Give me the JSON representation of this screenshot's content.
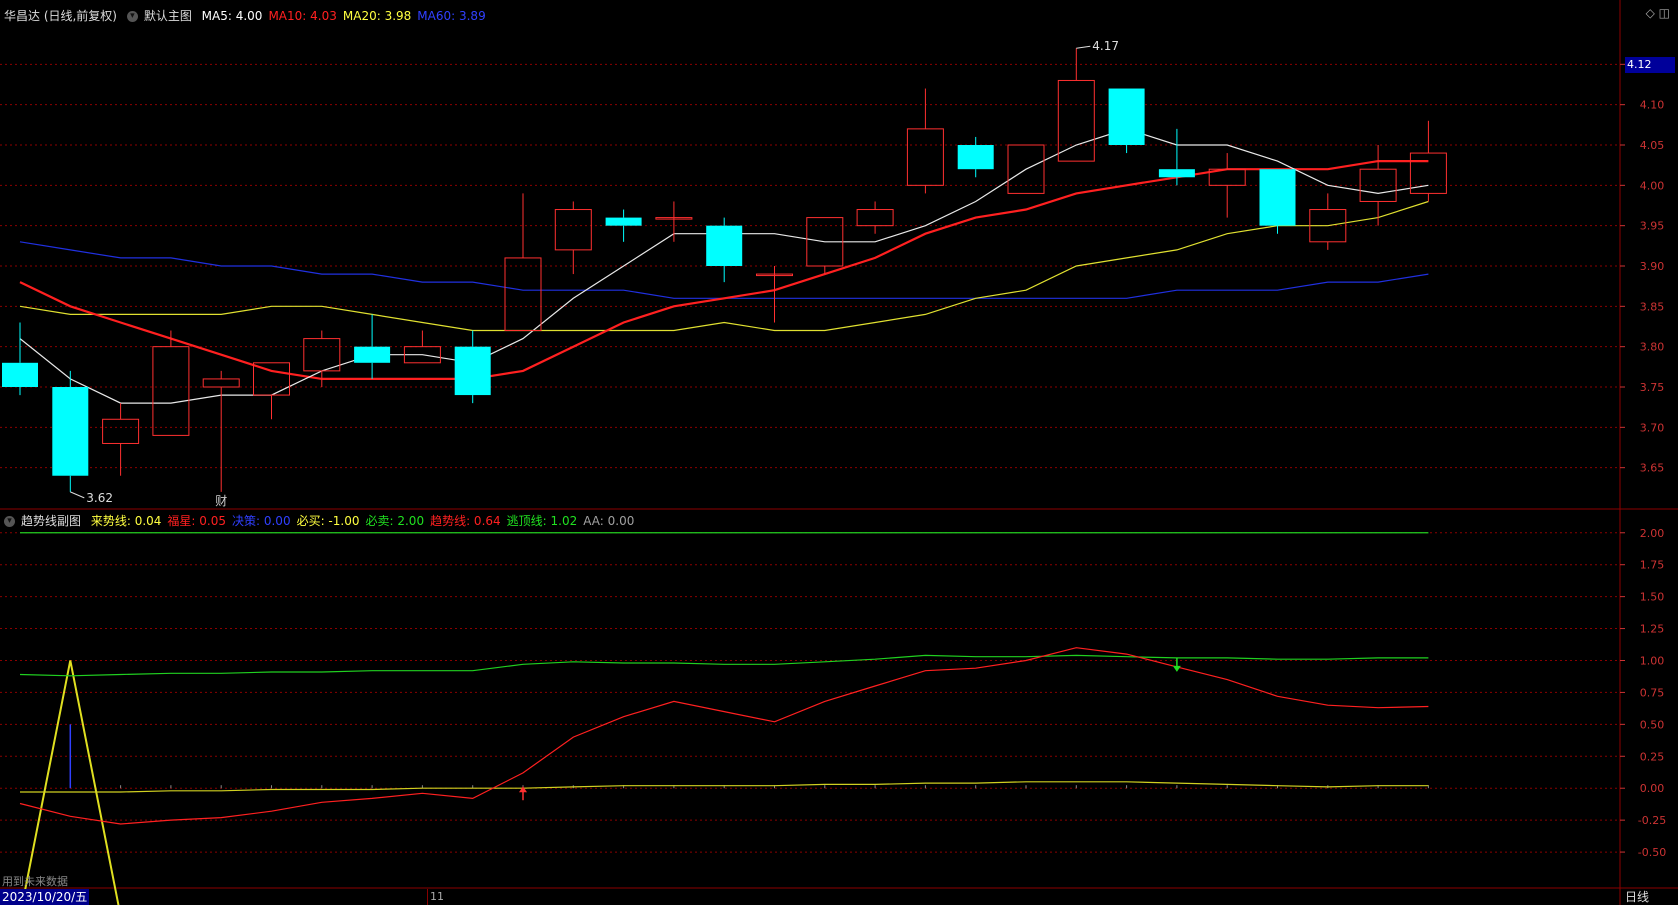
{
  "main_header": {
    "stock": "华昌达 (日线,前复权)",
    "template": "默认主图",
    "ma": [
      {
        "label": "MA5: 4.00",
        "color": "#ffffff"
      },
      {
        "label": "MA10: 4.03",
        "color": "#ff2020"
      },
      {
        "label": "MA20: 3.98",
        "color": "#ffff40"
      },
      {
        "label": "MA60: 3.89",
        "color": "#3040ff"
      }
    ]
  },
  "sub_header": {
    "title": "趋势线副图",
    "items": [
      {
        "label": "来势线: 0.04",
        "color": "#ffff40"
      },
      {
        "label": "福星: 0.05",
        "color": "#ff2020"
      },
      {
        "label": "决策: 0.00",
        "color": "#3040ff"
      },
      {
        "label": "必买: -1.00",
        "color": "#ffff40"
      },
      {
        "label": "必卖: 2.00",
        "color": "#20e020"
      },
      {
        "label": "趋势线: 0.64",
        "color": "#ff2020"
      },
      {
        "label": "逃顶线: 1.02",
        "color": "#20e020"
      },
      {
        "label": "AA: 0.00",
        "color": "#a0a0a0"
      }
    ]
  },
  "footer": {
    "date": "2023/10/20/五",
    "month_marker": "11",
    "period": "日线",
    "future_data": "用到未来数据"
  },
  "last_price_tag": "4.12",
  "colors": {
    "up": "#ff3030",
    "down": "#00ffff",
    "grid": "#8b0000"
  },
  "chart_data": [
    {
      "type": "candlestick",
      "yticks": [
        3.65,
        3.7,
        3.75,
        3.8,
        3.85,
        3.9,
        3.95,
        4.0,
        4.05,
        4.1,
        4.15
      ],
      "ylim": [
        3.6,
        4.2
      ],
      "candles": [
        {
          "o": 3.78,
          "h": 3.83,
          "l": 3.74,
          "c": 3.75
        },
        {
          "o": 3.75,
          "h": 3.77,
          "l": 3.62,
          "c": 3.64
        },
        {
          "o": 3.68,
          "h": 3.73,
          "l": 3.64,
          "c": 3.71
        },
        {
          "o": 3.69,
          "h": 3.82,
          "l": 3.69,
          "c": 3.8
        },
        {
          "o": 3.75,
          "h": 3.77,
          "l": 3.62,
          "c": 3.76
        },
        {
          "o": 3.74,
          "h": 3.78,
          "l": 3.71,
          "c": 3.78
        },
        {
          "o": 3.77,
          "h": 3.82,
          "l": 3.75,
          "c": 3.81
        },
        {
          "o": 3.8,
          "h": 3.84,
          "l": 3.76,
          "c": 3.78
        },
        {
          "o": 3.78,
          "h": 3.82,
          "l": 3.78,
          "c": 3.8
        },
        {
          "o": 3.8,
          "h": 3.82,
          "l": 3.73,
          "c": 3.74
        },
        {
          "o": 3.82,
          "h": 3.99,
          "l": 3.82,
          "c": 3.91
        },
        {
          "o": 3.92,
          "h": 3.98,
          "l": 3.89,
          "c": 3.97
        },
        {
          "o": 3.96,
          "h": 3.97,
          "l": 3.93,
          "c": 3.95
        },
        {
          "o": 3.96,
          "h": 3.98,
          "l": 3.93,
          "c": 3.96
        },
        {
          "o": 3.95,
          "h": 3.96,
          "l": 3.88,
          "c": 3.9
        },
        {
          "o": 3.89,
          "h": 3.9,
          "l": 3.83,
          "c": 3.89
        },
        {
          "o": 3.9,
          "h": 3.96,
          "l": 3.89,
          "c": 3.96
        },
        {
          "o": 3.95,
          "h": 3.98,
          "l": 3.94,
          "c": 3.97
        },
        {
          "o": 4.0,
          "h": 4.12,
          "l": 3.99,
          "c": 4.07
        },
        {
          "o": 4.05,
          "h": 4.06,
          "l": 4.01,
          "c": 4.02
        },
        {
          "o": 3.99,
          "h": 4.05,
          "l": 3.99,
          "c": 4.05
        },
        {
          "o": 4.03,
          "h": 4.17,
          "l": 4.03,
          "c": 4.13
        },
        {
          "o": 4.12,
          "h": 4.12,
          "l": 4.04,
          "c": 4.05
        },
        {
          "o": 4.02,
          "h": 4.07,
          "l": 4.0,
          "c": 4.01
        },
        {
          "o": 4.0,
          "h": 4.04,
          "l": 3.96,
          "c": 4.02
        },
        {
          "o": 4.02,
          "h": 4.02,
          "l": 3.94,
          "c": 3.95
        },
        {
          "o": 3.93,
          "h": 3.99,
          "l": 3.92,
          "c": 3.97
        },
        {
          "o": 3.98,
          "h": 4.05,
          "l": 3.95,
          "c": 4.02
        },
        {
          "o": 3.99,
          "h": 4.08,
          "l": 3.98,
          "c": 4.04
        }
      ],
      "ma5": [
        3.81,
        3.76,
        3.73,
        3.73,
        3.74,
        3.74,
        3.77,
        3.79,
        3.79,
        3.78,
        3.81,
        3.86,
        3.9,
        3.94,
        3.94,
        3.94,
        3.93,
        3.93,
        3.95,
        3.98,
        4.02,
        4.05,
        4.07,
        4.05,
        4.05,
        4.03,
        4.0,
        3.99,
        4.0
      ],
      "ma10": [
        3.88,
        3.85,
        3.83,
        3.81,
        3.79,
        3.77,
        3.76,
        3.76,
        3.76,
        3.76,
        3.77,
        3.8,
        3.83,
        3.85,
        3.86,
        3.87,
        3.89,
        3.91,
        3.94,
        3.96,
        3.97,
        3.99,
        4.0,
        4.01,
        4.02,
        4.02,
        4.02,
        4.03,
        4.03
      ],
      "ma20": [
        3.85,
        3.84,
        3.84,
        3.84,
        3.84,
        3.85,
        3.85,
        3.84,
        3.83,
        3.82,
        3.82,
        3.82,
        3.82,
        3.82,
        3.83,
        3.82,
        3.82,
        3.83,
        3.84,
        3.86,
        3.87,
        3.9,
        3.91,
        3.92,
        3.94,
        3.95,
        3.95,
        3.96,
        3.98
      ],
      "ma60": [
        3.93,
        3.92,
        3.91,
        3.91,
        3.9,
        3.9,
        3.89,
        3.89,
        3.88,
        3.88,
        3.87,
        3.87,
        3.87,
        3.86,
        3.86,
        3.86,
        3.86,
        3.86,
        3.86,
        3.86,
        3.86,
        3.86,
        3.86,
        3.87,
        3.87,
        3.87,
        3.88,
        3.88,
        3.89
      ],
      "annotations": [
        {
          "text": "4.17",
          "index": 21,
          "value": 4.17
        },
        {
          "text": "3.62",
          "index": 1,
          "value": 3.62
        },
        {
          "text": "财",
          "index": 4
        }
      ]
    },
    {
      "type": "line",
      "yticks": [
        -0.5,
        -0.25,
        0.0,
        0.25,
        0.5,
        0.75,
        1.0,
        1.25,
        1.5,
        1.75,
        2.0
      ],
      "ylim": [
        -0.75,
        2.1
      ],
      "bisell": 2.0,
      "bibuy": -1.0,
      "laishi": [
        -1.0,
        1.0,
        -0.5,
        -0.5,
        -0.5,
        -0.5,
        -0.5,
        -0.5,
        -0.5,
        -0.5,
        -0.5,
        -0.5,
        -0.5,
        -0.5,
        -0.5,
        -0.5,
        -0.5,
        -0.5,
        -0.5,
        -0.5,
        -0.5,
        -0.5,
        -0.5,
        -0.5,
        -0.5,
        -0.5,
        -0.5,
        -0.5,
        -0.5
      ],
      "laishi_note": "",
      "yellow_flat": [
        -0.03,
        -0.03,
        -0.03,
        -0.02,
        -0.02,
        -0.01,
        -0.01,
        -0.01,
        0.0,
        0.0,
        0.0,
        0.01,
        0.02,
        0.02,
        0.02,
        0.02,
        0.03,
        0.03,
        0.04,
        0.04,
        0.05,
        0.05,
        0.05,
        0.04,
        0.03,
        0.02,
        0.01,
        0.02,
        0.02
      ],
      "trend": [
        -0.12,
        -0.22,
        -0.28,
        -0.25,
        -0.23,
        -0.18,
        -0.11,
        -0.08,
        -0.04,
        -0.08,
        0.12,
        0.4,
        0.56,
        0.68,
        0.6,
        0.52,
        0.68,
        0.8,
        0.92,
        0.94,
        1.0,
        1.1,
        1.05,
        0.95,
        0.85,
        0.72,
        0.65,
        0.63,
        0.64
      ],
      "escape": [
        0.89,
        0.88,
        0.89,
        0.9,
        0.9,
        0.91,
        0.91,
        0.92,
        0.92,
        0.92,
        0.97,
        0.99,
        0.98,
        0.98,
        0.97,
        0.97,
        0.99,
        1.01,
        1.04,
        1.03,
        1.03,
        1.04,
        1.03,
        1.02,
        1.02,
        1.01,
        1.01,
        1.02,
        1.02
      ],
      "juece_index": 1,
      "juece_value": 0.5,
      "buy_arrow_index": 10,
      "sell_arrow_index": 23
    }
  ]
}
